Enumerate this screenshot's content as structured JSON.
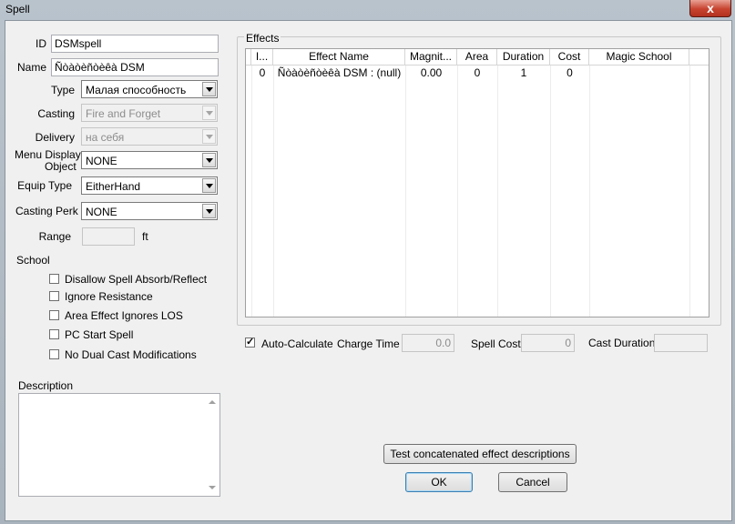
{
  "window": {
    "title": "Spell",
    "close_glyph": "x"
  },
  "form": {
    "id_label": "ID",
    "id_value": "DSMspell",
    "name_label": "Name",
    "name_value": "Ñòàòèñòèêà DSM",
    "type_label": "Type",
    "type_value": "Малая способность",
    "casting_label": "Casting",
    "casting_value": "Fire and Forget",
    "delivery_label": "Delivery",
    "delivery_value": "на себя",
    "menu_display_label_1": "Menu Display",
    "menu_display_label_2": "Object",
    "menu_display_value": "NONE",
    "equip_type_label": "Equip Type",
    "equip_type_value": "EitherHand",
    "casting_perk_label": "Casting Perk",
    "casting_perk_value": "NONE",
    "range_label": "Range",
    "range_value": "",
    "range_unit": "ft"
  },
  "school": {
    "label": "School",
    "options": [
      {
        "label": "Disallow Spell Absorb/Reflect",
        "checked": false
      },
      {
        "label": "Ignore Resistance",
        "checked": false
      },
      {
        "label": "Area Effect Ignores LOS",
        "checked": false
      },
      {
        "label": "PC Start Spell",
        "checked": false
      },
      {
        "label": "No Dual Cast Modifications",
        "checked": false
      }
    ]
  },
  "description": {
    "label": "Description",
    "value": ""
  },
  "effects": {
    "label": "Effects",
    "columns": [
      "I...",
      "Effect Name",
      "Magnit...",
      "Area",
      "Duration",
      "Cost",
      "Magic School"
    ],
    "rows": [
      {
        "index": "0",
        "effect_name": "Ñòàòèñòèêà DSM : (null)",
        "magnitude": "0.00",
        "area": "0",
        "duration": "1",
        "cost": "0",
        "magic_school": ""
      }
    ]
  },
  "calc": {
    "auto_calculate_label": "Auto-Calculate",
    "auto_calculate_checked": true,
    "charge_time_label": "Charge Time",
    "charge_time_value": "0.0",
    "spell_cost_label": "Spell Cost",
    "spell_cost_value": "0",
    "cast_duration_label": "Cast Duration",
    "cast_duration_value": ""
  },
  "buttons": {
    "test_label": "Test concatenated effect descriptions",
    "ok_label": "OK",
    "cancel_label": "Cancel"
  },
  "colors": {
    "close_button": "#c7432f",
    "default_button_border": "#3c7fb1"
  }
}
